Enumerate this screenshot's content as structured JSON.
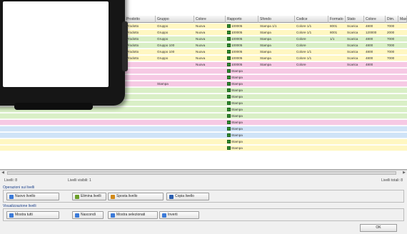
{
  "columns": [
    "",
    "Prodotto",
    "Gruppo",
    "Colore",
    "Rapporto",
    "Sfondo",
    "Codice",
    "Formato",
    "Stato",
    "Colore",
    "Dim.",
    "Max."
  ],
  "rows": [
    {
      "bg": "#fff7c2",
      "cells": [
        "",
        "Prodotto",
        "Gruppo",
        "Nuova",
        "100005",
        "Stampa 1/1",
        "Colore 1/1",
        "8001",
        "Scarica",
        "4800",
        "7000",
        ""
      ]
    },
    {
      "bg": "#fff7c2",
      "cells": [
        "",
        "Prodotto",
        "Gruppo",
        "Nuova",
        "100005",
        "Stampa",
        "Colore 1/1",
        "8001",
        "Scarica",
        "120000",
        "2000",
        ""
      ]
    },
    {
      "bg": "#d9efc6",
      "cells": [
        "",
        "Prodotto",
        "Gruppo",
        "Nuova",
        "100005",
        "Stampa",
        "Colore",
        "1/1",
        "Scarica",
        "4800",
        "7000",
        ""
      ]
    },
    {
      "bg": "#d9efc6",
      "cells": [
        "",
        "Prodotto",
        "Gruppo 100",
        "Nuova",
        "100005",
        "Stampa",
        "Colore",
        "",
        "Scarica",
        "4800",
        "7000",
        ""
      ]
    },
    {
      "bg": "#fff7c2",
      "cells": [
        "",
        "Prodotto",
        "Gruppo 100",
        "Nuova",
        "100005",
        "Stampa",
        "Colore 1/1",
        "",
        "Scarica",
        "4800",
        "7000",
        ""
      ]
    },
    {
      "bg": "#fff7c2",
      "cells": [
        "",
        "Prodotto",
        "Gruppo",
        "Nuova",
        "100005",
        "Stampa",
        "Colore 1/1",
        "",
        "Scarica",
        "4800",
        "7000",
        ""
      ]
    },
    {
      "bg": "#f6c9e4",
      "cells": [
        "",
        "",
        "",
        "Nuova",
        "100005",
        "Stampa",
        "Colore",
        "",
        "Scarica",
        "4800",
        "",
        ""
      ]
    },
    {
      "bg": "#f6c9e4",
      "cells": [
        "",
        "",
        "",
        "",
        "Stampa",
        "",
        "",
        "",
        "",
        "",
        "",
        ""
      ]
    },
    {
      "bg": "#f6c9e4",
      "cells": [
        "",
        "",
        "",
        "",
        "Stampa",
        "",
        "",
        "",
        "",
        "",
        "",
        ""
      ]
    },
    {
      "bg": "#f6c9e4",
      "cells": [
        "",
        "",
        "Stampa",
        "",
        "Stampa",
        "",
        "",
        "",
        "",
        "",
        "",
        ""
      ]
    },
    {
      "bg": "#d9efc6",
      "cells": [
        "",
        "",
        "",
        "",
        "Stampa",
        "",
        "",
        "",
        "",
        "",
        "",
        ""
      ]
    },
    {
      "bg": "#d9efc6",
      "cells": [
        "",
        "",
        "",
        "",
        "Stampa",
        "",
        "",
        "",
        "",
        "",
        "",
        ""
      ]
    },
    {
      "bg": "#d9efc6",
      "cells": [
        "",
        "",
        "",
        "",
        "Stampa",
        "",
        "",
        "",
        "",
        "",
        "",
        ""
      ]
    },
    {
      "bg": "#d9efc6",
      "cells": [
        "",
        "",
        "",
        "",
        "Stampa",
        "",
        "",
        "",
        "",
        "",
        "",
        ""
      ]
    },
    {
      "bg": "#d9efc6",
      "cells": [
        "",
        "",
        "",
        "",
        "Stampa",
        "",
        "",
        "",
        "",
        "",
        "",
        ""
      ]
    },
    {
      "bg": "#f6c9e4",
      "cells": [
        "",
        "",
        "",
        "",
        "Stampa",
        "",
        "",
        "",
        "",
        "",
        "",
        ""
      ]
    },
    {
      "bg": "#cfe3f7",
      "cells": [
        "",
        "",
        "",
        "",
        "Stampa",
        "",
        "",
        "",
        "",
        "",
        "",
        ""
      ]
    },
    {
      "bg": "#cfe3f7",
      "cells": [
        "",
        "",
        "",
        "",
        "Stampa",
        "",
        "",
        "",
        "",
        "",
        "",
        ""
      ]
    },
    {
      "bg": "#fff7c2",
      "cells": [
        "",
        "",
        "",
        "",
        "Stampa",
        "",
        "",
        "",
        "",
        "",
        "",
        ""
      ]
    },
    {
      "bg": "#fff7c2",
      "cells": [
        "",
        "",
        "",
        "",
        "Stampa",
        "",
        "",
        "",
        "",
        "",
        "",
        ""
      ]
    },
    {
      "bg": "#ffffff",
      "cells": [
        "",
        "",
        "",
        "",
        "",
        "",
        "",
        "",
        "",
        "",
        "",
        ""
      ]
    }
  ],
  "status": {
    "left": "Livelli: 8",
    "mid": "Livelli visibili: 1",
    "right": "Livelli totali: 8"
  },
  "group1": {
    "title": "Operazioni sui livelli",
    "buttons": [
      {
        "label": "Nuovo livello",
        "color": "#3b7ad8"
      },
      {
        "label": "Elimina livelli",
        "color": "#6c9f2a"
      },
      {
        "label": "Sposta livello",
        "color": "#d28a19"
      },
      {
        "label": "Copia livello",
        "color": "#2c5fb0"
      }
    ]
  },
  "group2": {
    "title": "Visualizzazione livelli",
    "buttons": [
      {
        "label": "Mostra tutti",
        "color": "#3b7ad8"
      },
      {
        "label": "Nascondi",
        "color": "#3b7ad8"
      },
      {
        "label": "Mostra selezionati",
        "color": "#3b7ad8"
      },
      {
        "label": "Inverti",
        "color": "#3b7ad8"
      }
    ]
  },
  "ok_label": "OK"
}
